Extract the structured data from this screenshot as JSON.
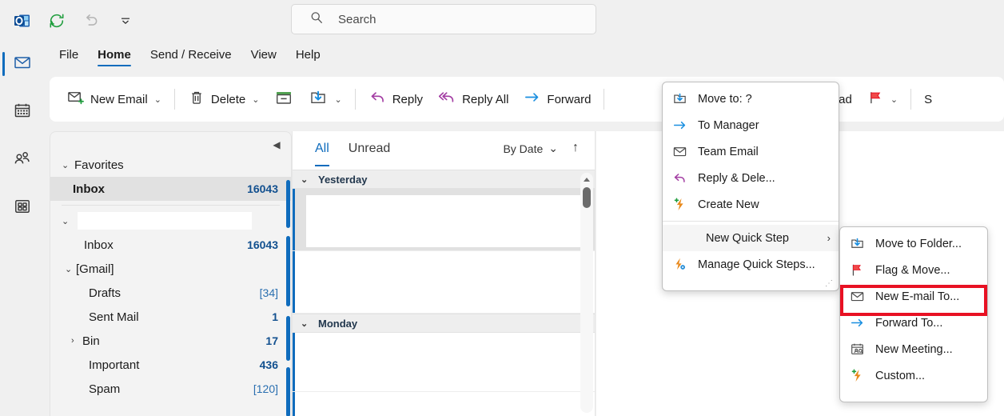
{
  "window": {
    "app_icon": "outlook-icon"
  },
  "quick_access": [
    {
      "name": "outlook-logo-icon",
      "label": "Outlook"
    },
    {
      "name": "send-receive-all-icon",
      "label": "Send/Receive All Folders"
    },
    {
      "name": "undo-icon",
      "label": "Undo"
    },
    {
      "name": "customize-quick-access-toolbar-icon",
      "label": "Customize Quick Access Toolbar"
    }
  ],
  "search": {
    "placeholder": "Search",
    "value": "Search",
    "icon": "search-icon"
  },
  "ribbon_tabs": [
    {
      "label": "File",
      "active": false
    },
    {
      "label": "Home",
      "active": true
    },
    {
      "label": "Send / Receive",
      "active": false
    },
    {
      "label": "View",
      "active": false
    },
    {
      "label": "Help",
      "active": false
    }
  ],
  "rail": [
    {
      "name": "mail-icon",
      "label": "Mail",
      "active": true
    },
    {
      "name": "calendar-icon",
      "label": "Calendar",
      "active": false
    },
    {
      "name": "people-icon",
      "label": "People",
      "active": false
    },
    {
      "name": "apps-icon",
      "label": "More apps",
      "active": false
    }
  ],
  "ribbon": {
    "new_email": "New Email",
    "delete": "Delete",
    "archive_icon": "archive-icon",
    "move_icon": "move-to-icon",
    "reply": "Reply",
    "reply_all": "Reply All",
    "forward": "Forward",
    "unread_read": "Unread/ Read",
    "flag_icon": "flag-icon",
    "cut_off_button": "S",
    "caret": "⌄"
  },
  "folder_pane": {
    "collapse_icon": "collapse-pane-icon",
    "favorites": {
      "label": "Favorites",
      "expanded": true,
      "items": [
        {
          "name": "Inbox",
          "count": "16043",
          "selected": true,
          "bracket": false
        }
      ]
    },
    "account": {
      "label": "",
      "redacted": true,
      "expanded": true,
      "items": [
        {
          "name": "Inbox",
          "count": "16043",
          "indent": 1,
          "bracket": false,
          "expandable": false
        },
        {
          "name": "[Gmail]",
          "count": "",
          "indent": 0,
          "bracket": false,
          "expandable": true,
          "expanded": true
        },
        {
          "name": "Drafts",
          "count": "[34]",
          "indent": 2,
          "bracket": true,
          "expandable": false
        },
        {
          "name": "Sent Mail",
          "count": "1",
          "indent": 2,
          "bracket": false,
          "expandable": false
        },
        {
          "name": "Bin",
          "count": "17",
          "indent": 1,
          "bracket": false,
          "expandable": true,
          "expanded": false
        },
        {
          "name": "Important",
          "count": "436",
          "indent": 2,
          "bracket": false,
          "expandable": false
        },
        {
          "name": "Spam",
          "count": "[120]",
          "indent": 2,
          "bracket": true,
          "expandable": false
        }
      ]
    }
  },
  "message_list": {
    "filter_tabs": [
      {
        "label": "All",
        "active": true
      },
      {
        "label": "Unread",
        "active": false
      }
    ],
    "sort_label": "By Date",
    "sort_caret": "⌄",
    "sort_direction_icon": "sort-ascending-icon",
    "groups": [
      {
        "label": "Yesterday",
        "expanded": true
      },
      {
        "label": "Monday",
        "expanded": true
      }
    ]
  },
  "quick_steps_menu": {
    "items": [
      {
        "label": "Move to: ?",
        "icon": "move-to-folder-icon",
        "accel": "",
        "type": "item"
      },
      {
        "label": "To Manager",
        "icon": "forward-arrow-icon",
        "accel": "",
        "type": "item"
      },
      {
        "label": "Team Email",
        "icon": "envelope-icon",
        "accel": "",
        "type": "item"
      },
      {
        "label": "Reply & Dele...",
        "icon": "reply-icon",
        "accel": "",
        "type": "item"
      },
      {
        "label": "Create New",
        "icon": "new-quick-step-icon",
        "accel": "",
        "type": "item"
      },
      {
        "type": "separator"
      },
      {
        "label": "New Quick Step",
        "icon": "",
        "accel": "N",
        "type": "submenu",
        "hover": true,
        "arrow": "›"
      },
      {
        "label": "Manage Quick Steps...",
        "icon": "manage-quick-steps-icon",
        "accel": "M",
        "type": "item"
      }
    ],
    "resize_grip": "⋰"
  },
  "new_quick_step_submenu": {
    "items": [
      {
        "label": "Move to Folder...",
        "icon": "move-to-folder-icon",
        "accel": "M",
        "highlighted": false
      },
      {
        "label": "Flag & Move...",
        "icon": "flag-move-icon",
        "accel": "g",
        "highlighted": false
      },
      {
        "label": "New E-mail To...",
        "icon": "envelope-icon",
        "accel": "N",
        "highlighted": true
      },
      {
        "label": "Forward To...",
        "icon": "forward-arrow-icon",
        "accel": "F",
        "highlighted": false
      },
      {
        "label": "New Meeting...",
        "icon": "new-meeting-icon",
        "accel": "w",
        "highlighted": false
      },
      {
        "label": "Custom...",
        "icon": "new-quick-step-icon",
        "accel": "C",
        "highlighted": false
      }
    ]
  },
  "colors": {
    "accent": "#0f6cbd",
    "highlight_box": "#e81123",
    "count_blue": "#12508f",
    "reply_purple": "#a33ea3",
    "archive_green": "#51a251",
    "flag_red": "#e81123"
  }
}
